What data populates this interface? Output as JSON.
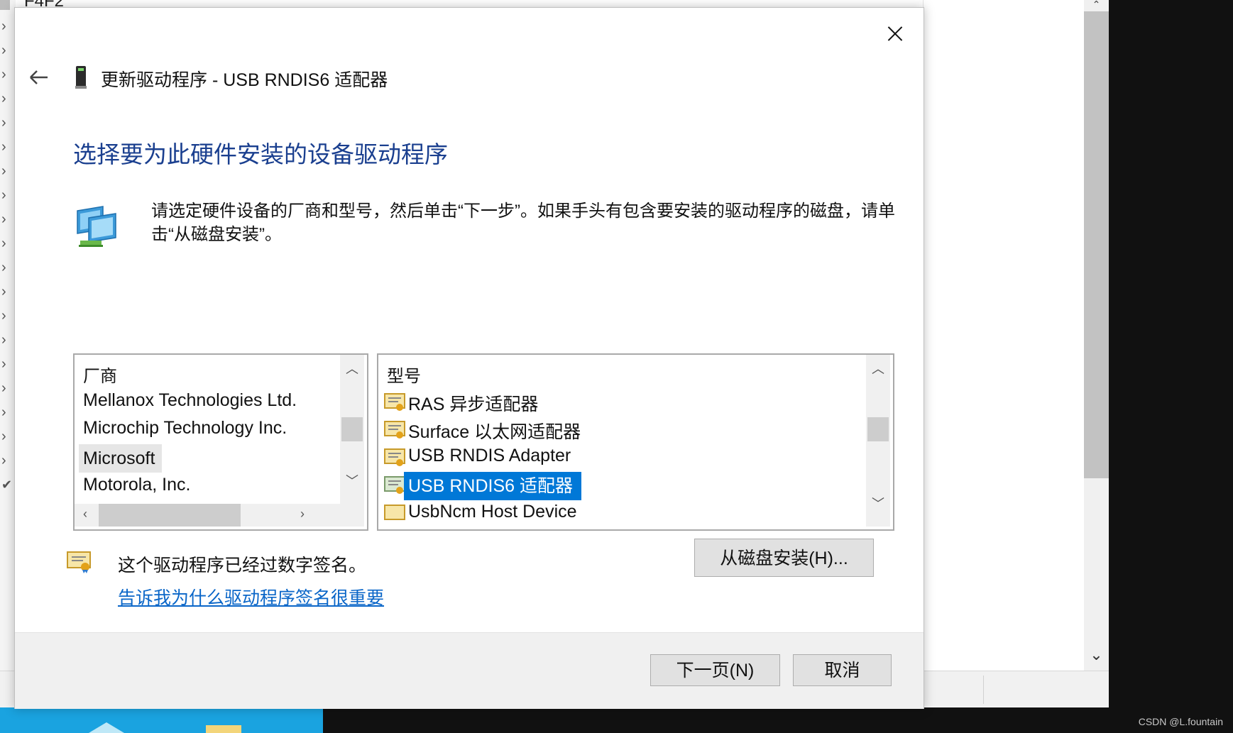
{
  "background": {
    "top_left_text": "F4F2",
    "watermark": "CSDN @L.fountain"
  },
  "dialog": {
    "title": "更新驱动程序 - USB RNDIS6 适配器",
    "heading": "选择要为此硬件安装的设备驱动程序",
    "instructions": "请选定硬件设备的厂商和型号，然后单击“下一步”。如果手头有包含要安装的驱动程序的磁盘，请单击“从磁盘安装”。",
    "manufacturer_list": {
      "header": "厂商",
      "items": [
        "Mellanox Technologies Ltd.",
        "Microchip Technology Inc.",
        "Microsoft",
        "Motorola, Inc."
      ],
      "selected": "Microsoft"
    },
    "model_list": {
      "header": "型号",
      "items": [
        "RAS 异步适配器",
        "Surface 以太网适配器",
        "USB RNDIS Adapter",
        "USB RNDIS6 适配器",
        "UsbNcm Host Device"
      ],
      "selected": "USB RNDIS6 适配器"
    },
    "signed_text": "这个驱动程序已经过数字签名。",
    "signed_link": "告诉我为什么驱动程序签名很重要",
    "have_disk_button": "从磁盘安装(H)...",
    "next_button": "下一页(N)",
    "cancel_button": "取消"
  },
  "colors": {
    "heading": "#1a3f8f",
    "link": "#0a66c8",
    "selection": "#0078d7",
    "taskbar_blue": "#1aa3e0"
  },
  "icons": {
    "back": "back-arrow-icon",
    "close": "close-icon",
    "device": "usb-device-icon",
    "network": "network-adapter-icon",
    "certificate": "signed-driver-icon"
  }
}
